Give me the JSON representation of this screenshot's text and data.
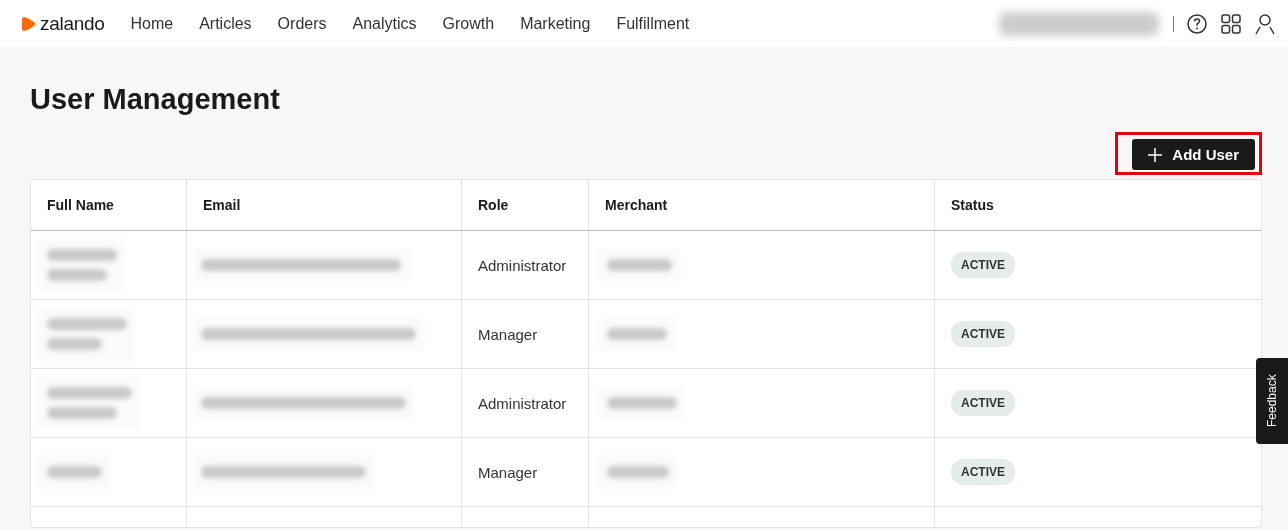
{
  "brand": {
    "name": "zalando"
  },
  "nav": [
    {
      "label": "Home"
    },
    {
      "label": "Articles"
    },
    {
      "label": "Orders"
    },
    {
      "label": "Analytics"
    },
    {
      "label": "Growth"
    },
    {
      "label": "Marketing"
    },
    {
      "label": "Fulfillment"
    }
  ],
  "page_title": "User Management",
  "add_button": {
    "label": "Add User",
    "highlighted": true
  },
  "table": {
    "columns": [
      "Full Name",
      "Email",
      "Role",
      "Merchant",
      "Status"
    ],
    "rows": [
      {
        "role": "Administrator",
        "status": "ACTIVE"
      },
      {
        "role": "Manager",
        "status": "ACTIVE"
      },
      {
        "role": "Administrator",
        "status": "ACTIVE"
      },
      {
        "role": "Manager",
        "status": "ACTIVE"
      }
    ]
  },
  "feedback_tab": "Feedback"
}
